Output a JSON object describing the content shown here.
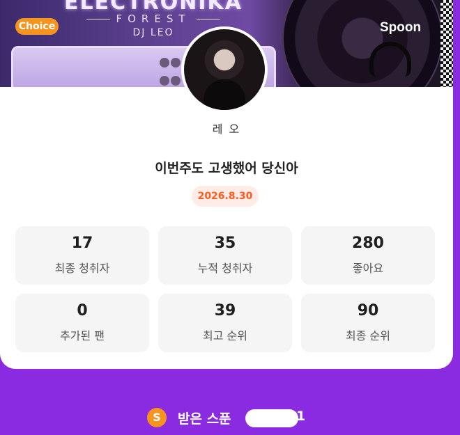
{
  "banner": {
    "title": "ELECTRONIKA",
    "subtitle": "FOREST",
    "dj": "DJ LEO",
    "choice_badge": "Choice",
    "spoon_logo": "Spoon"
  },
  "profile": {
    "name": "레 오"
  },
  "cast": {
    "title": "이번주도 고생했어 당신아",
    "date": "2026.8.30"
  },
  "stats": [
    {
      "value": "17",
      "label": "최종 청취자"
    },
    {
      "value": "35",
      "label": "누적 청취자"
    },
    {
      "value": "280",
      "label": "좋아요"
    },
    {
      "value": "0",
      "label": "추가된 팬"
    },
    {
      "value": "39",
      "label": "최고 순위"
    },
    {
      "value": "90",
      "label": "최종 순위"
    }
  ],
  "footer": {
    "coin_symbol": "S",
    "label": "받은 스푼",
    "count_visible": "1"
  },
  "colors": {
    "background": "#8a2be2",
    "accent_orange": "#f7941d",
    "date_text": "#ff5a1f",
    "date_bg": "#ffece6"
  }
}
